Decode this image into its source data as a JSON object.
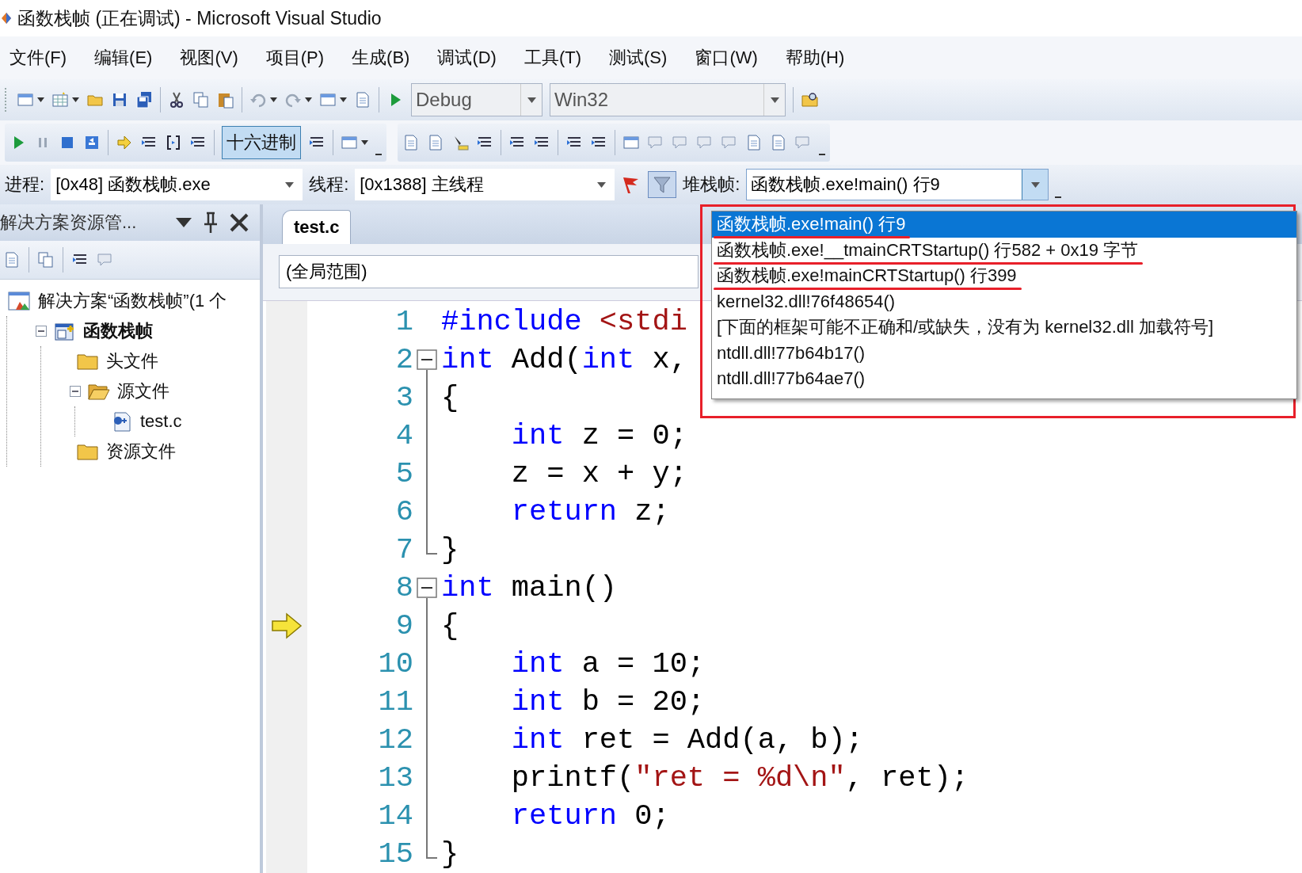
{
  "window": {
    "title": "函数栈帧 (正在调试) - Microsoft Visual Studio"
  },
  "menu": [
    "文件(F)",
    "编辑(E)",
    "视图(V)",
    "项目(P)",
    "生成(B)",
    "调试(D)",
    "工具(T)",
    "测试(S)",
    "窗口(W)",
    "帮助(H)"
  ],
  "standard_toolbar": {
    "configuration": {
      "value": "Debug",
      "disabled": true
    },
    "platform": {
      "value": "Win32",
      "disabled": true
    }
  },
  "debug_toolbar": {
    "hex_button": {
      "label": "十六进制",
      "selected": true
    }
  },
  "debug_location": {
    "process_label": "进程:",
    "process": "[0x48] 函数栈帧.exe",
    "thread_label": "线程:",
    "thread": "[0x1388] 主线程",
    "stack_frame_label": "堆栈帧:",
    "stack_frame": "函数栈帧.exe!main()  行9",
    "stack_frame_open": true
  },
  "stack_frames": [
    {
      "text": "函数栈帧.exe!main()  行9",
      "selected": true,
      "underlined": true
    },
    {
      "text": "函数栈帧.exe!__tmainCRTStartup()  行582 + 0x19 字节",
      "selected": false,
      "underlined": true
    },
    {
      "text": "函数栈帧.exe!mainCRTStartup()  行399",
      "selected": false,
      "underlined": true
    },
    {
      "text": "kernel32.dll!76f48654()",
      "selected": false,
      "underlined": false
    },
    {
      "text": "[下面的框架可能不正确和/或缺失，没有为 kernel32.dll 加载符号]",
      "selected": false,
      "underlined": false
    },
    {
      "text": "ntdll.dll!77b64b17()",
      "selected": false,
      "underlined": false
    },
    {
      "text": "ntdll.dll!77b64ae7()",
      "selected": false,
      "underlined": false
    }
  ],
  "solution_explorer": {
    "title": "解决方案资源管...",
    "tree": [
      {
        "label": "解决方案“函数栈帧”(1 个",
        "kind": "solution",
        "children": [
          {
            "label": "函数栈帧",
            "kind": "project",
            "expanded": true,
            "children": [
              {
                "label": "头文件",
                "kind": "folder"
              },
              {
                "label": "源文件",
                "kind": "folder",
                "expanded": true,
                "children": [
                  {
                    "label": "test.c",
                    "kind": "file"
                  }
                ]
              },
              {
                "label": "资源文件",
                "kind": "folder"
              }
            ]
          }
        ]
      }
    ]
  },
  "editor": {
    "tab": {
      "label": "test.c",
      "selected": true
    },
    "scope": "(全局范围)",
    "lines": [
      {
        "number": "1",
        "tokens": [
          {
            "kind": "preproc",
            "text": "#include "
          },
          {
            "kind": "string",
            "text": "<stdi"
          }
        ]
      },
      {
        "number": "2",
        "expanded": true,
        "tokens": [
          {
            "kind": "keyword",
            "text": "int"
          },
          {
            "kind": "plain",
            "text": " Add("
          },
          {
            "kind": "keyword",
            "text": "int"
          },
          {
            "kind": "plain",
            "text": " x,"
          }
        ],
        "children": [
          {
            "number": "3",
            "tokens": [
              {
                "kind": "plain",
                "text": "{"
              }
            ]
          },
          {
            "number": "4",
            "tokens": [
              {
                "kind": "keyword",
                "text": "    int"
              },
              {
                "kind": "plain",
                "text": " z = 0;"
              }
            ]
          },
          {
            "number": "5",
            "tokens": [
              {
                "kind": "plain",
                "text": "    z = x + y;"
              }
            ]
          },
          {
            "number": "6",
            "tokens": [
              {
                "kind": "keyword",
                "text": "    return"
              },
              {
                "kind": "plain",
                "text": " z;"
              }
            ]
          },
          {
            "number": "7",
            "tokens": [
              {
                "kind": "plain",
                "text": "}"
              }
            ]
          }
        ]
      },
      {
        "number": "8",
        "expanded": true,
        "tokens": [
          {
            "kind": "keyword",
            "text": "int"
          },
          {
            "kind": "plain",
            "text": " main()"
          }
        ],
        "children": [
          {
            "number": "9",
            "current": true,
            "tokens": [
              {
                "kind": "plain",
                "text": "{"
              }
            ]
          },
          {
            "number": "10",
            "tokens": [
              {
                "kind": "keyword",
                "text": "    int"
              },
              {
                "kind": "plain",
                "text": " a = 10;"
              }
            ]
          },
          {
            "number": "11",
            "tokens": [
              {
                "kind": "keyword",
                "text": "    int"
              },
              {
                "kind": "plain",
                "text": " b = 20;"
              }
            ]
          },
          {
            "number": "12",
            "tokens": [
              {
                "kind": "keyword",
                "text": "    int"
              },
              {
                "kind": "plain",
                "text": " ret = Add(a, b);"
              }
            ]
          },
          {
            "number": "13",
            "tokens": [
              {
                "kind": "plain",
                "text": "    printf("
              },
              {
                "kind": "string",
                "text": "\"ret = %d\\n\""
              },
              {
                "kind": "plain",
                "text": ", ret);"
              }
            ]
          },
          {
            "number": "14",
            "tokens": [
              {
                "kind": "keyword",
                "text": "    return"
              },
              {
                "kind": "plain",
                "text": " 0;"
              }
            ]
          },
          {
            "number": "15",
            "tokens": [
              {
                "kind": "plain",
                "text": "}"
              }
            ]
          }
        ]
      }
    ]
  }
}
